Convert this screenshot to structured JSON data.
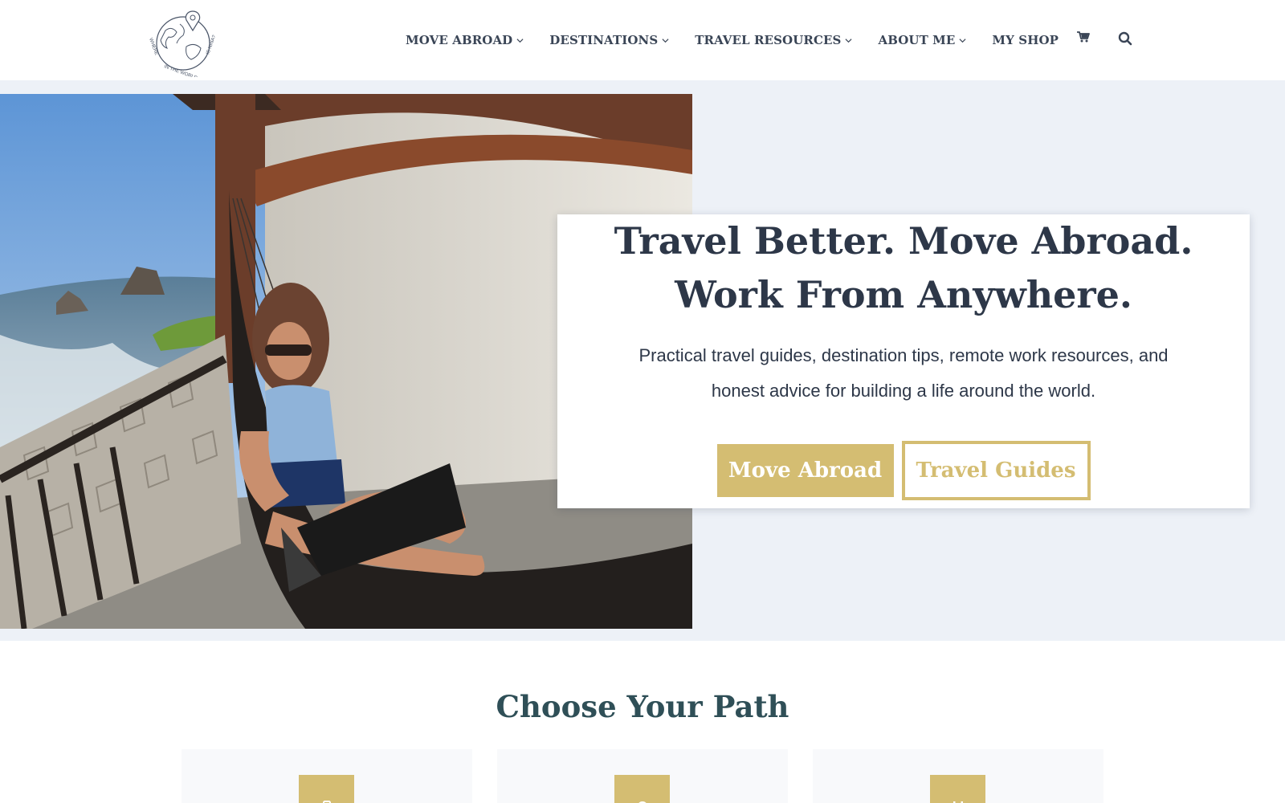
{
  "header": {
    "logo_text": "WHERE IN THE WORLD IS NINA?",
    "nav": [
      {
        "label": "MOVE ABROAD",
        "has_dropdown": true
      },
      {
        "label": "DESTINATIONS",
        "has_dropdown": true
      },
      {
        "label": "TRAVEL RESOURCES",
        "has_dropdown": true
      },
      {
        "label": "ABOUT ME",
        "has_dropdown": true
      },
      {
        "label": "MY SHOP",
        "has_dropdown": false
      }
    ],
    "cart_icon": "cart-icon",
    "search_icon": "search-icon"
  },
  "hero": {
    "title": "Travel Better. Move Abroad. Work From Anywhere.",
    "subtitle": "Practical travel guides, destination tips, remote work resources, and honest advice for building a life around the world.",
    "primary_button": "Move Abroad",
    "secondary_button": "Travel Guides"
  },
  "path": {
    "title": "Choose Your Path",
    "cards": [
      {
        "icon": "suitcase-icon"
      },
      {
        "icon": "map-pin-icon"
      },
      {
        "icon": "calendar-icon"
      }
    ]
  },
  "colors": {
    "accent": "#d4bd72",
    "text_dark": "#2d3748",
    "heading_teal": "#2f4f57",
    "hero_bg": "#edf1f7"
  }
}
